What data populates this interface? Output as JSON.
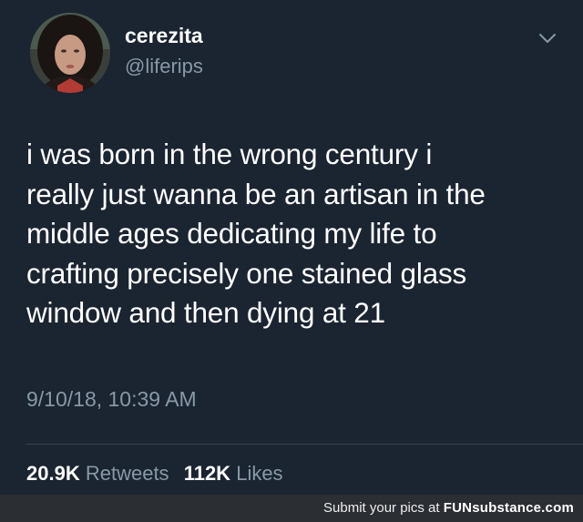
{
  "tweet": {
    "display_name": "cerezita",
    "handle": "@liferips",
    "text_lines": [
      "i was born in the wrong century i",
      "really just wanna be an artisan in the",
      "middle ages dedicating my life to",
      "crafting precisely one stained glass",
      "window and then dying at 21"
    ],
    "timestamp": "9/10/18, 10:39 AM",
    "retweets_count": "20.9K",
    "retweets_label": "Retweets",
    "likes_count": "112K",
    "likes_label": "Likes"
  },
  "footer": {
    "text": "Submit your pics at",
    "logo_fun": "FUN",
    "logo_substance": "substance.com"
  },
  "icons": {
    "caret": "chevron-down-icon",
    "avatar": "profile-photo"
  },
  "colors": {
    "background": "#1b2431",
    "secondary_text": "#8899a6",
    "primary_text": "#ffffff",
    "divider": "#38444d",
    "footer_bg": "#2b2e33"
  }
}
